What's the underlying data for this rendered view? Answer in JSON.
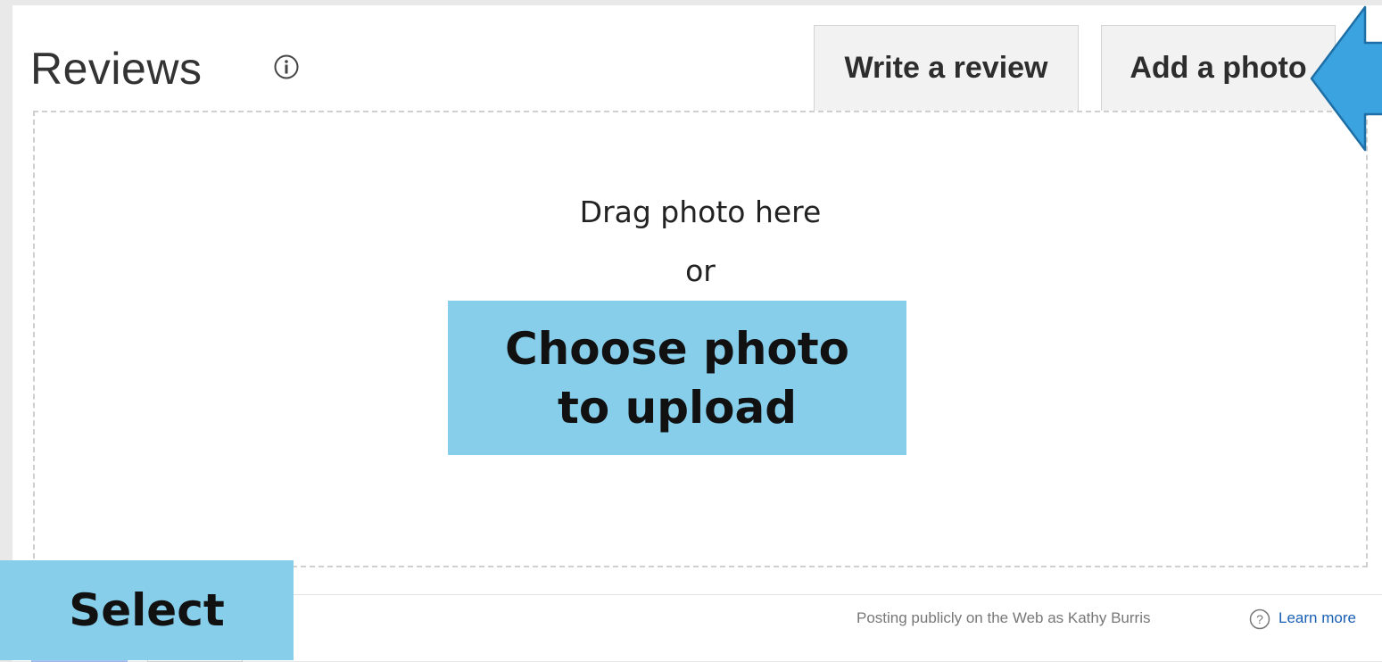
{
  "reviews": {
    "title": "Reviews",
    "info_icon": "info-circle-icon"
  },
  "tabs": [
    {
      "label": "Write a review"
    },
    {
      "label": "Add a photo"
    }
  ],
  "upload": {
    "drag_text": "Drag photo here",
    "or_text": "or",
    "choose_line1": "Choose photo",
    "choose_line2": "to upload"
  },
  "annotation": {
    "select_label": "Select",
    "arrow_icon": "pointer-arrow-icon",
    "highlight_color": "#87ceeb",
    "arrow_color": "#3ba3e0"
  },
  "footer": {
    "posting_text": "Posting publicly on the Web as Kathy Burris",
    "help_icon": "question-circle-icon",
    "learn_more": "Learn more"
  }
}
